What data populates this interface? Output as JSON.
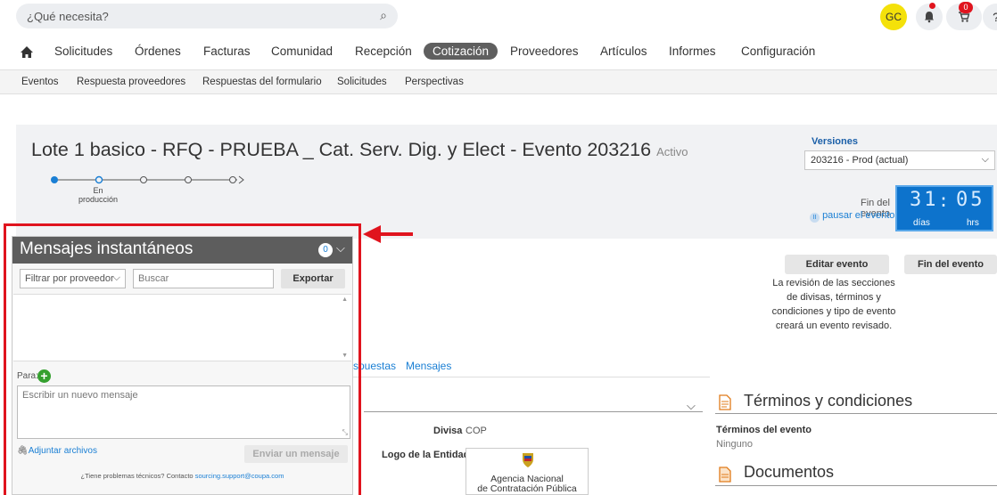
{
  "topbar": {
    "search_placeholder": "¿Qué necesita?",
    "avatar_initials": "GC",
    "cart_count": "0",
    "help_label": "?"
  },
  "mainnav": {
    "items": [
      "Solicitudes",
      "Órdenes",
      "Facturas",
      "Comunidad",
      "Recepción",
      "Cotización",
      "Proveedores",
      "Artículos",
      "Informes",
      "Configuración"
    ],
    "active": "Cotización"
  },
  "subnav": {
    "items": [
      "Eventos",
      "Respuesta proveedores",
      "Respuestas del formulario",
      "Solicitudes",
      "Perspectivas"
    ]
  },
  "event": {
    "title": "Lote 1 basico - RFQ - PRUEBA _ Cat. Serv. Dig. y Elect - Evento 203216",
    "status": "Activo",
    "stage_label_1": "En",
    "stage_label_2": "producción"
  },
  "versions": {
    "label": "Versiones",
    "selected": "203216 - Prod (actual)"
  },
  "timer": {
    "end_label": "Fin del evento",
    "pause_link": "pausar el evento",
    "days": "31",
    "hours": "05",
    "days_label": "días",
    "hours_label": "hrs"
  },
  "actions": {
    "edit_event": "Editar evento",
    "end_event": "Fin del evento",
    "revision_note": "La revisión de las secciones de divisas, términos y condiciones y tipo de evento creará un evento revisado."
  },
  "tabs": {
    "responses_partial": "spuestas",
    "messages": "Mensajes"
  },
  "details": {
    "currency_label": "Divisa",
    "currency_value": "COP",
    "logo_label": "Logo de la Entidad",
    "logo_text_1": "Agencia Nacional",
    "logo_text_2": "de Contratación Pública"
  },
  "terms": {
    "title": "Términos y condiciones",
    "event_terms_label": "Términos del evento",
    "event_terms_value": "Ninguno",
    "documents_title": "Documentos"
  },
  "chat": {
    "title": "Mensajes instantáneos",
    "count": "0",
    "filter_placeholder": "Filtrar por proveedor",
    "search_placeholder": "Buscar",
    "export_label": "Exportar",
    "to_label": "Para:",
    "message_placeholder": "Escribir un nuevo mensaje",
    "attach_label": "Adjuntar archivos",
    "send_label": "Enviar un mensaje",
    "help_text": "¿Tiene problemas técnicos? Contacto",
    "help_email": "sourcing.support@coupa.com"
  },
  "colors": {
    "accent_blue": "#1a7fd4",
    "timer_blue": "#0d73cc",
    "highlight_red": "#e0141e",
    "chat_header": "#5d5d5d"
  },
  "icons": [
    "search-icon",
    "bell-icon",
    "cart-icon",
    "home-icon",
    "chevron-down-icon",
    "pause-icon",
    "add-icon",
    "paperclip-icon",
    "document-icon",
    "arrow-icon"
  ]
}
